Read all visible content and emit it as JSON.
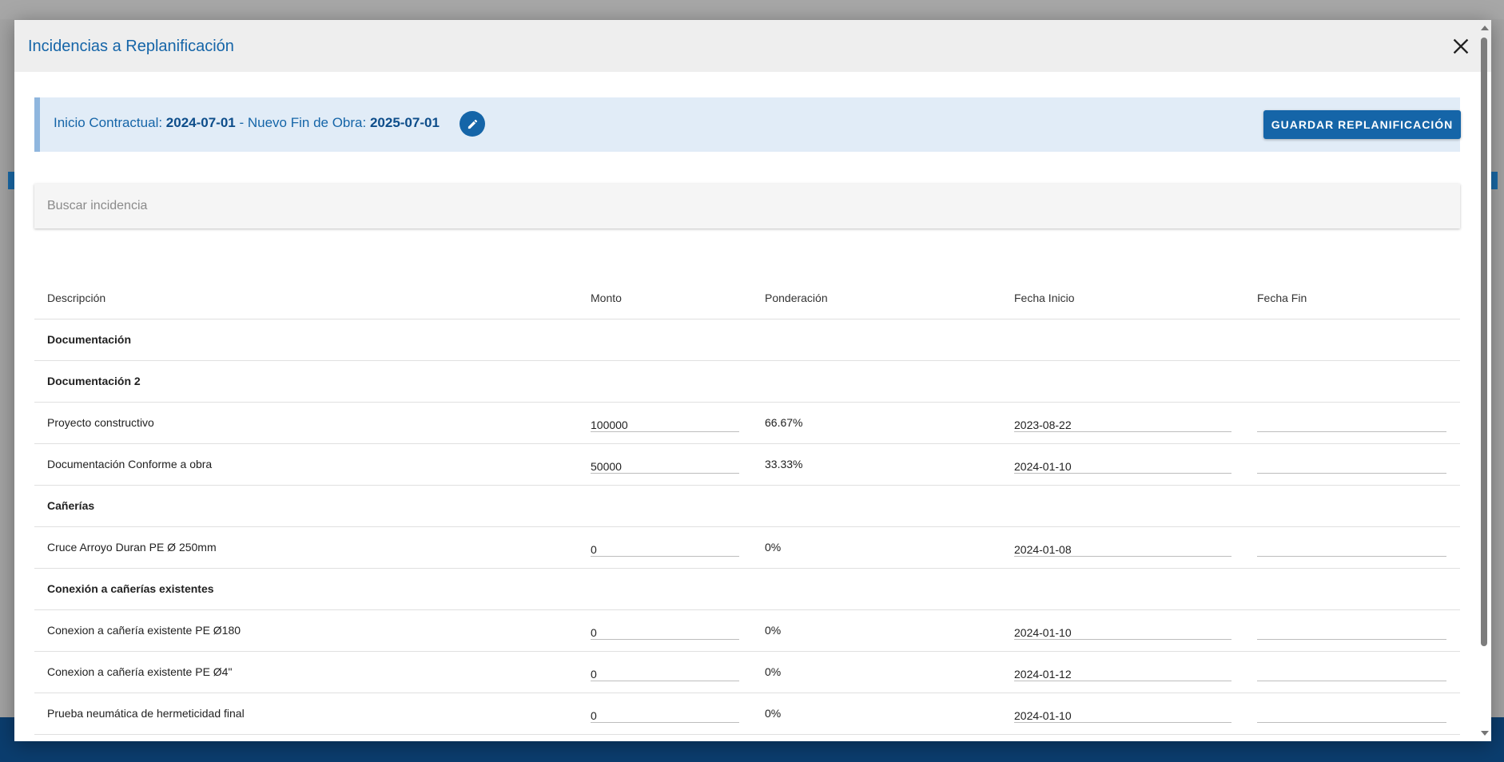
{
  "modal": {
    "title": "Incidencias a Replanificación"
  },
  "banner": {
    "inicio_label": "Inicio Contractual: ",
    "inicio_value": "2024-07-01",
    "separator": " - ",
    "fin_label": "Nuevo Fin de Obra: ",
    "fin_value": "2025-07-01",
    "save_label": "GUARDAR REPLANIFICACIÓN"
  },
  "search": {
    "placeholder": "Buscar incidencia"
  },
  "table": {
    "headers": [
      "Descripción",
      "Monto",
      "Ponderación",
      "Fecha Inicio",
      "Fecha Fin"
    ],
    "rows": [
      {
        "type": "group",
        "descripcion": "Documentación"
      },
      {
        "type": "group",
        "descripcion": "Documentación 2"
      },
      {
        "type": "item",
        "descripcion": "Proyecto constructivo",
        "monto": "100000",
        "ponderacion": "66.67%",
        "fecha_inicio": "2023-08-22",
        "fecha_fin": ""
      },
      {
        "type": "item",
        "descripcion": "Documentación Conforme a obra",
        "monto": "50000",
        "ponderacion": "33.33%",
        "fecha_inicio": "2024-01-10",
        "fecha_fin": ""
      },
      {
        "type": "group",
        "descripcion": "Cañerías"
      },
      {
        "type": "item",
        "descripcion": "Cruce Arroyo Duran PE Ø 250mm",
        "monto": "0",
        "ponderacion": "0%",
        "fecha_inicio": "2024-01-08",
        "fecha_fin": ""
      },
      {
        "type": "group",
        "descripcion": "Conexión a cañerías existentes"
      },
      {
        "type": "item",
        "descripcion": "Conexion a cañería existente PE Ø180",
        "monto": "0",
        "ponderacion": "0%",
        "fecha_inicio": "2024-01-10",
        "fecha_fin": ""
      },
      {
        "type": "item",
        "descripcion": "Conexion a cañería existente PE Ø4\"",
        "monto": "0",
        "ponderacion": "0%",
        "fecha_inicio": "2024-01-12",
        "fecha_fin": ""
      },
      {
        "type": "item",
        "descripcion": "Prueba neumática de hermeticidad final",
        "monto": "0",
        "ponderacion": "0%",
        "fecha_inicio": "2024-01-10",
        "fecha_fin": ""
      }
    ]
  },
  "colors": {
    "primary": "#1565a8",
    "banner_bg": "#e1ecf7",
    "header_bg": "#eeeeee",
    "footer_bg": "#0b3d6e"
  },
  "icons": [
    "close-icon",
    "edit-pencil-icon",
    "scroll-up-icon",
    "scroll-down-icon"
  ]
}
